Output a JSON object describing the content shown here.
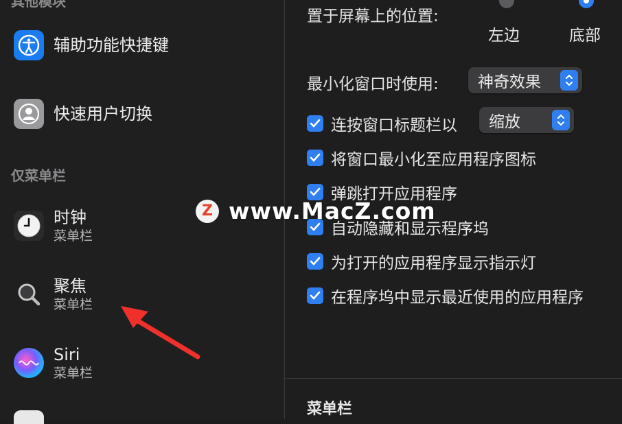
{
  "sidebar": {
    "section_top": "其他模块",
    "section_menubar": "仅菜单栏",
    "items": [
      {
        "title": "辅助功能快捷键",
        "icon": "accessibility-icon"
      },
      {
        "title": "快速用户切换",
        "icon": "user-switch-icon"
      },
      {
        "title": "时钟",
        "subtitle": "菜单栏",
        "icon": "clock-icon"
      },
      {
        "title": "聚焦",
        "subtitle": "菜单栏",
        "icon": "spotlight-icon"
      },
      {
        "title": "Siri",
        "subtitle": "菜单栏",
        "icon": "siri-icon"
      }
    ]
  },
  "dock": {
    "position_label": "置于屏幕上的位置:",
    "position_options": [
      "左边",
      "底部"
    ],
    "position_selected": "底部",
    "minimize_label": "最小化窗口时使用:",
    "minimize_value": "神奇效果",
    "double_click_label": "连按窗口标题栏以",
    "double_click_value": "缩放",
    "checkboxes": [
      {
        "label": "将窗口最小化至应用程序图标",
        "checked": true
      },
      {
        "label": "弹跳打开应用程序",
        "checked": true
      },
      {
        "label": "自动隐藏和显示程序坞",
        "checked": true
      },
      {
        "label": "为打开的应用程序显示指示灯",
        "checked": true
      },
      {
        "label": "在程序坞中显示最近使用的应用程序",
        "checked": true
      }
    ],
    "checked_double_click": true,
    "menubar_heading": "菜单栏"
  },
  "watermark": {
    "text": "www.MacZ.com",
    "logo_letter": "Z"
  },
  "colors": {
    "accent": "#2f7ff0",
    "background": "#1e1e1f",
    "arrow": "#f0302a"
  }
}
